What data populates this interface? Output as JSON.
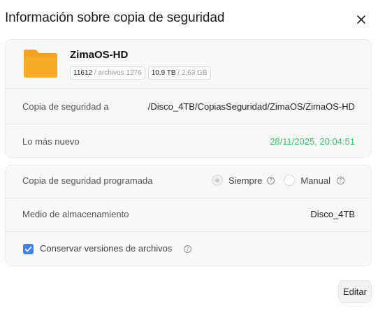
{
  "dialog": {
    "title": "Información sobre copia de seguridad",
    "close_icon": "close-icon"
  },
  "source": {
    "folder_icon": "folder-icon",
    "folder_color": "#f5a21c",
    "name": "ZimaOS-HD",
    "files_count": "11612",
    "files_suffix": " / archivos 1276",
    "size_value": "10.9 TB",
    "size_suffix": " / 2.63 GB"
  },
  "destination": {
    "label": "Copia de seguridad a",
    "value": "/Disco_4TB/CopiasSeguridad/ZimaOS/ZimaOS-HD"
  },
  "latest": {
    "label": "Lo más nuevo",
    "value": "28/11/2025, 20:04:51",
    "value_color": "#3dc46c"
  },
  "schedule": {
    "label": "Copia de seguridad programada",
    "options": [
      {
        "label": "Siempre",
        "selected": true
      },
      {
        "label": "Manual",
        "selected": false
      }
    ]
  },
  "storage": {
    "label": "Medio de almacenamiento",
    "value": "Disco_4TB"
  },
  "keep_versions": {
    "label": "Conservar versiones de archivos",
    "checked": true,
    "accent": "#3b82f6"
  },
  "actions": {
    "edit_label": "Editar"
  }
}
